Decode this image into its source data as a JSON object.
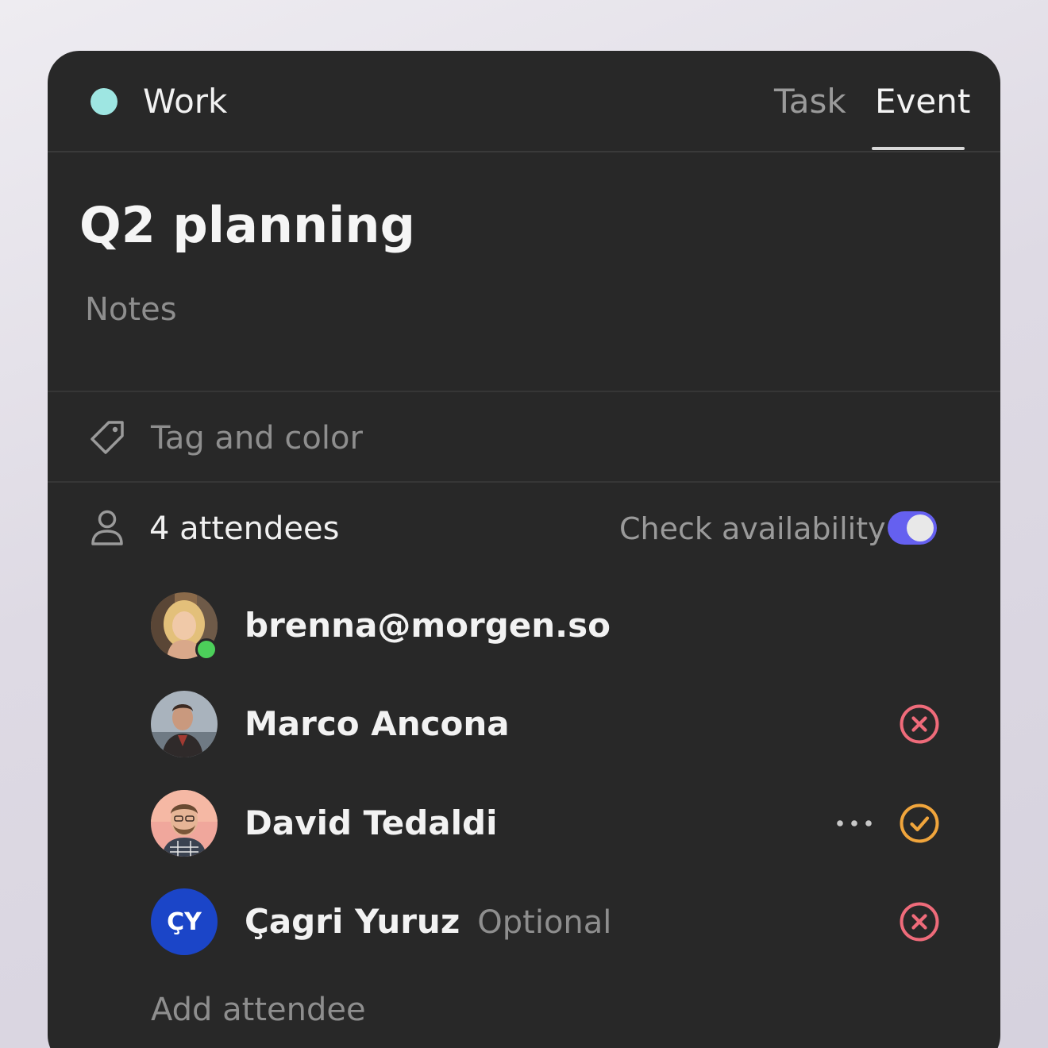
{
  "calendar": {
    "name": "Work",
    "color": "#9ee6e2"
  },
  "tabs": [
    {
      "label": "Task",
      "active": false
    },
    {
      "label": "Event",
      "active": true
    }
  ],
  "event": {
    "title": "Q2 planning",
    "notes_placeholder": "Notes"
  },
  "tag": {
    "label": "Tag and color",
    "icon": "tag-icon"
  },
  "attendees_section": {
    "count_label": "4 attendees",
    "icon": "person-icon",
    "check_availability_label": "Check availability",
    "check_availability_on": true,
    "toggle_color": "#6560f0"
  },
  "attendees": [
    {
      "name": "brenna@morgen.so",
      "avatar": "photo",
      "online": true,
      "status": "none"
    },
    {
      "name": "Marco Ancona",
      "avatar": "photo",
      "status": "declined",
      "status_icon": "x-circle-icon",
      "status_color": "#ef6b7a"
    },
    {
      "name": "David Tedaldi",
      "avatar": "photo",
      "status": "accepted",
      "status_icon": "check-circle-icon",
      "status_color": "#f0a53c",
      "has_more": true
    },
    {
      "name": "Çagri Yuruz",
      "initials": "ÇY",
      "tag": "Optional",
      "status": "declined",
      "status_icon": "x-circle-icon",
      "status_color": "#ef6b7a"
    }
  ],
  "add_attendee_placeholder": "Add attendee",
  "colors": {
    "online": "#4ccf5a",
    "initials_bg": "#1b45c8"
  }
}
